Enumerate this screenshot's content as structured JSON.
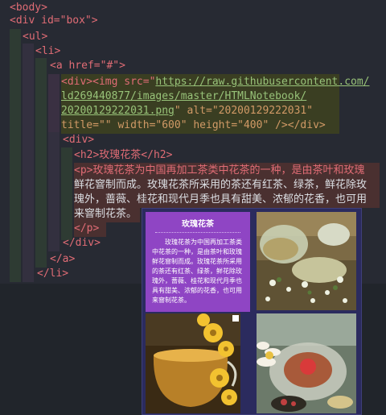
{
  "code": {
    "body_open": "<body>",
    "div_box": "<div id=\"box\">",
    "ul_open": "<ul>",
    "li_open": "<li>",
    "a_href": "<a href=\"#\">",
    "img_line1_pre": "<div><img src=\"",
    "img_url_1": "https://raw.githubusercontent.com/",
    "img_url_2": "ld269440877/images/master/HTMLNotebook/",
    "img_url_3": "20200129222031.png",
    "img_line3_post": "\" alt=\"20200129222031\"",
    "img_line4": "title=\"\" width=\"600\" height=\"400\" /></div>",
    "div_open": "<div>",
    "h2_line": "<h2>玫瑰花茶</h2>",
    "p_line1": "<p>玫瑰花茶为中国再加工茶类中花茶的一种，是由茶叶和玫瑰",
    "p_line2": "鲜花窨制而成。玫瑰花茶所采用的茶还有红茶、绿茶，鲜花除玫",
    "p_line3": "瑰外，蔷薇、桂花和现代月季也具有甜美、浓郁的花香，也可用",
    "p_line4": "来窨制花茶。",
    "p_close": "</p>",
    "div_close": "</div>",
    "a_close": "</a>",
    "li_close": "</li>"
  },
  "preview": {
    "card_title": "玫瑰花茶",
    "card_text": "玫瑰花茶为中国再加工茶类中花茶的一种，是由茶叶和玫瑰鲜花窨制而成。玫瑰花茶所采用的茶还有红茶、绿茶，鲜花除玫瑰外，蔷薇、桂花和现代月季也具有甜美、浓郁的花香，也可用来窨制花茶。"
  },
  "colors": {
    "editor_bg": "#272a33",
    "tag": "#e06c75",
    "attr": "#d19a66",
    "string": "#98c379",
    "card_purple": "#8f45c4",
    "preview_bg": "#2b2b5e"
  }
}
